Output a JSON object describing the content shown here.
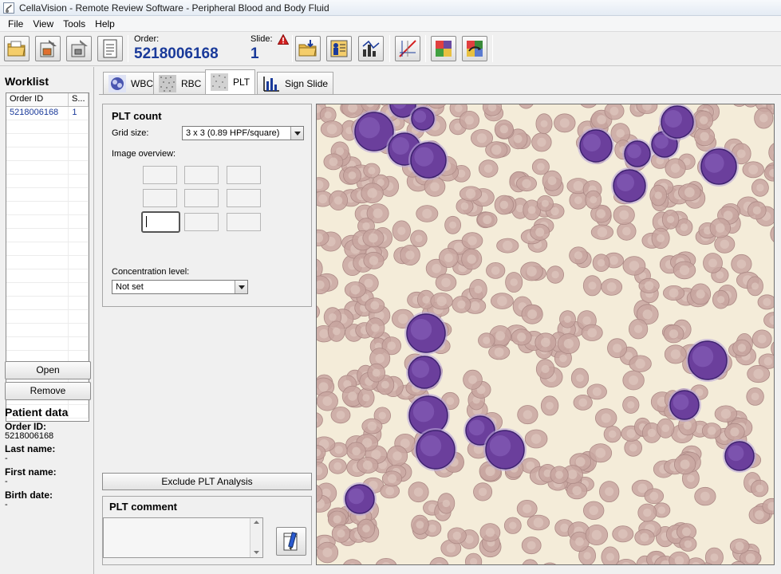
{
  "window": {
    "title": "CellaVision - Remote Review Software - Peripheral Blood and Body Fluid"
  },
  "menu": [
    "File",
    "View",
    "Tools",
    "Help"
  ],
  "toolbar": {
    "order_label": "Order:",
    "order_value": "5218006168",
    "slide_label": "Slide:",
    "slide_value": "1",
    "left_buttons": [
      "open-folder-icon",
      "save-slide-icon",
      "print-icon",
      "report-icon"
    ],
    "right_buttons": [
      "import-folder-icon",
      "patient-info-icon",
      "statistics-icon",
      "calibrate-icon",
      "color-grid-icon",
      "color-swap-icon"
    ]
  },
  "worklist": {
    "title": "Worklist",
    "columns": [
      "Order ID",
      "S..."
    ],
    "rows": [
      {
        "order_id": "5218006168",
        "slide": "1"
      }
    ],
    "open_label": "Open",
    "remove_label": "Remove"
  },
  "patient": {
    "title": "Patient data",
    "fields": [
      {
        "label": "Order ID:",
        "value": "5218006168"
      },
      {
        "label": "Last name:",
        "value": "-"
      },
      {
        "label": "First name:",
        "value": "-"
      },
      {
        "label": "Birth date:",
        "value": "-"
      }
    ]
  },
  "tabs": [
    {
      "label": "WBC",
      "icon": "wbc-cell-icon",
      "active": false
    },
    {
      "label": "RBC",
      "icon": "rbc-pattern-icon",
      "active": false
    },
    {
      "label": "PLT",
      "icon": "plt-pattern-icon",
      "active": true
    },
    {
      "label": "Sign Slide",
      "icon": "sign-slide-chart-icon",
      "active": false
    }
  ],
  "plt_count": {
    "title": "PLT count",
    "grid_size_label": "Grid size:",
    "grid_size_value": "3 x 3  (0.89 HPF/square)",
    "image_overview_label": "Image overview:",
    "concentration_label": "Concentration level:",
    "concentration_value": "Not set",
    "selected_cell": {
      "row": 3,
      "col": 1
    }
  },
  "exclude_button": "Exclude PLT Analysis",
  "comment": {
    "title": "PLT comment",
    "text": ""
  },
  "colors": {
    "order_blue": "#1a3a9a",
    "warning_red": "#d42020",
    "cell_purple": "#6b3f9c",
    "background_cream": "#f4ecd9",
    "rbc_pink": "#c8a6a0"
  }
}
